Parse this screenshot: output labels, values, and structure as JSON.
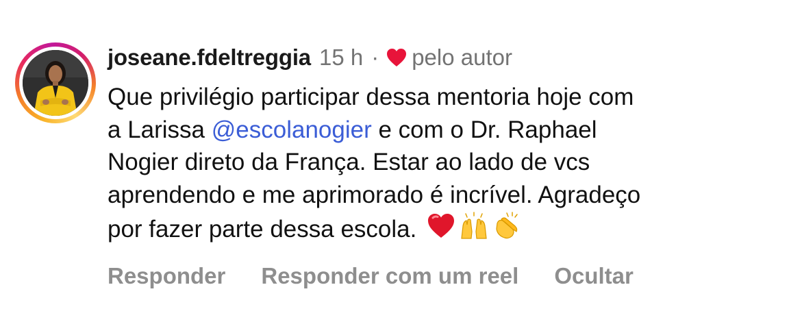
{
  "comment": {
    "username": "joseane.fdeltreggia",
    "timestamp": "15 h",
    "separator": "·",
    "liked_by_label": "pelo autor",
    "heart_icon": "heart-icon",
    "heart_color": "#e8143a",
    "mention_color": "#3b5dd6",
    "lines": [
      {
        "text": "Que privilégio participar dessa mentoria hoje com"
      },
      {
        "before": "a Larissa ",
        "mention": "@escolanogier",
        "after": " e com o Dr. Raphael"
      },
      {
        "text": "Nogier direto da França.  Estar ao lado de vcs"
      },
      {
        "text": "aprendendo e me aprimorado é incrível. Agradeço"
      },
      {
        "text": "por fazer parte dessa escola."
      }
    ],
    "emojis": [
      "red-heart-emoji",
      "raising-hands-emoji",
      "clapping-hands-emoji"
    ]
  },
  "actions": {
    "reply": "Responder",
    "reply_with_reel": "Responder com um reel",
    "hide": "Ocultar"
  }
}
